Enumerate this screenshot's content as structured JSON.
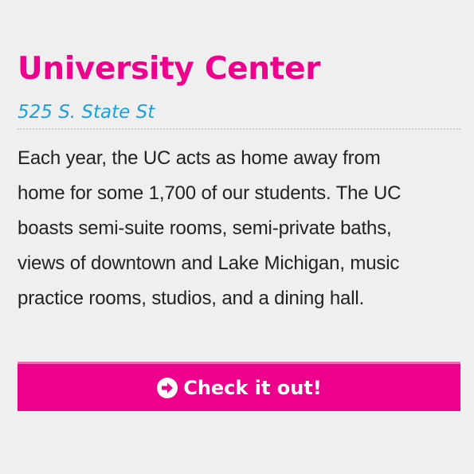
{
  "card": {
    "title": "University Center",
    "address": "525 S. State St",
    "description_lines": [
      "Each year, the UC acts as home away from",
      "home for some 1,700 of our students. The UC",
      "boasts semi-suite rooms, semi-private baths,",
      "views of downtown and Lake Michigan, music",
      "practice rooms, studios, and a dining hall."
    ],
    "cta": {
      "label": "Check it out!",
      "icon": "arrow-circle-right-icon"
    }
  },
  "colors": {
    "background": "#efefef",
    "title": "#ec008c",
    "address": "#1fa0d8",
    "body_text": "#222222",
    "button_bg": "#ec008c",
    "button_text": "#ffffff"
  }
}
